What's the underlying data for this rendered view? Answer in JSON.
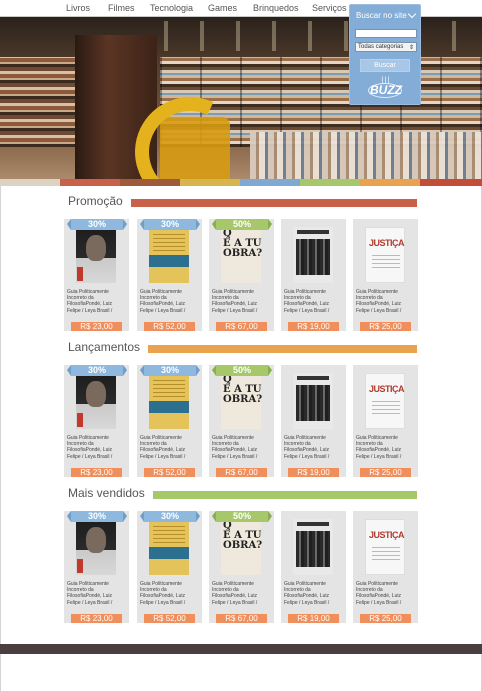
{
  "nav": [
    "Livros",
    "Filmes",
    "Tecnologia",
    "Games",
    "Brinquedos",
    "Serviços"
  ],
  "search": {
    "heading": "Buscar no site",
    "input_value": "",
    "select_value": "Todas categorias",
    "button_label": "Buscar",
    "logo_text": "BUZZ"
  },
  "stripe_colors": [
    "#dcd3c4",
    "#c9614a",
    "#9e5b3b",
    "#d6b64c",
    "#7fa8d2",
    "#a6c86a",
    "#e9a24e",
    "#c24d3b"
  ],
  "sections": [
    {
      "title": "Promoção",
      "bar_color": "#c9614a",
      "products": [
        {
          "badge": "30%",
          "badge_color": "blue",
          "desc": "Guia Politicamente Incorreto da FilosofiaPondé, Luiz Felipe / Leya Brasil /",
          "price": "R$ 23,00"
        },
        {
          "badge": "30%",
          "badge_color": "blue",
          "desc": "Guia Politicamente Incorreto da FilosofiaPondé, Luiz Felipe / Leya Brasil /",
          "price": "R$ 52,00"
        },
        {
          "badge": "50%",
          "badge_color": "green",
          "desc": "Guia Politicamente Incorreto da FilosofiaPondé, Luiz Felipe / Leya Brasil /",
          "price": "R$ 67,00"
        },
        {
          "badge": "",
          "badge_color": "",
          "desc": "Guia Politicamente Incorreto da FilosofiaPondé, Luiz Felipe / Leya Brasil /",
          "price": "R$ 19,00"
        },
        {
          "badge": "",
          "badge_color": "",
          "desc": "Guia Politicamente Incorreto da FilosofiaPondé, Luiz Felipe / Leya Brasil /",
          "price": "R$ 25,00"
        }
      ]
    },
    {
      "title": "Lançamentos",
      "bar_color": "#e9a24e",
      "products": [
        {
          "badge": "30%",
          "badge_color": "blue",
          "desc": "Guia Politicamente Incorreto da FilosofiaPondé, Luiz Felipe / Leya Brasil /",
          "price": "R$ 23,00"
        },
        {
          "badge": "30%",
          "badge_color": "blue",
          "desc": "Guia Politicamente Incorreto da FilosofiaPondé, Luiz Felipe / Leya Brasil /",
          "price": "R$ 52,00"
        },
        {
          "badge": "50%",
          "badge_color": "green",
          "desc": "Guia Politicamente Incorreto da FilosofiaPondé, Luiz Felipe / Leya Brasil /",
          "price": "R$ 67,00"
        },
        {
          "badge": "",
          "badge_color": "",
          "desc": "Guia Politicamente Incorreto da FilosofiaPondé, Luiz Felipe / Leya Brasil /",
          "price": "R$ 19,00"
        },
        {
          "badge": "",
          "badge_color": "",
          "desc": "Guia Politicamente Incorreto da FilosofiaPondé, Luiz Felipe / Leya Brasil /",
          "price": "R$ 25,00"
        }
      ]
    },
    {
      "title": "Mais vendidos",
      "bar_color": "#a6c86a",
      "products": [
        {
          "badge": "30%",
          "badge_color": "blue",
          "desc": "Guia Politicamente Incorreto da FilosofiaPondé, Luiz Felipe / Leya Brasil /",
          "price": "R$ 23,00"
        },
        {
          "badge": "30%",
          "badge_color": "blue",
          "desc": "Guia Politicamente Incorreto da FilosofiaPondé, Luiz Felipe / Leya Brasil /",
          "price": "R$ 52,00"
        },
        {
          "badge": "50%",
          "badge_color": "green",
          "desc": "Guia Politicamente Incorreto da FilosofiaPondé, Luiz Felipe / Leya Brasil /",
          "price": "R$ 67,00"
        },
        {
          "badge": "",
          "badge_color": "",
          "desc": "Guia Politicamente Incorreto da FilosofiaPondé, Luiz Felipe / Leya Brasil /",
          "price": "R$ 19,00"
        },
        {
          "badge": "",
          "badge_color": "",
          "desc": "Guia Politicamente Incorreto da FilosofiaPondé, Luiz Felipe / Leya Brasil /",
          "price": "R$ 25,00"
        }
      ]
    }
  ]
}
